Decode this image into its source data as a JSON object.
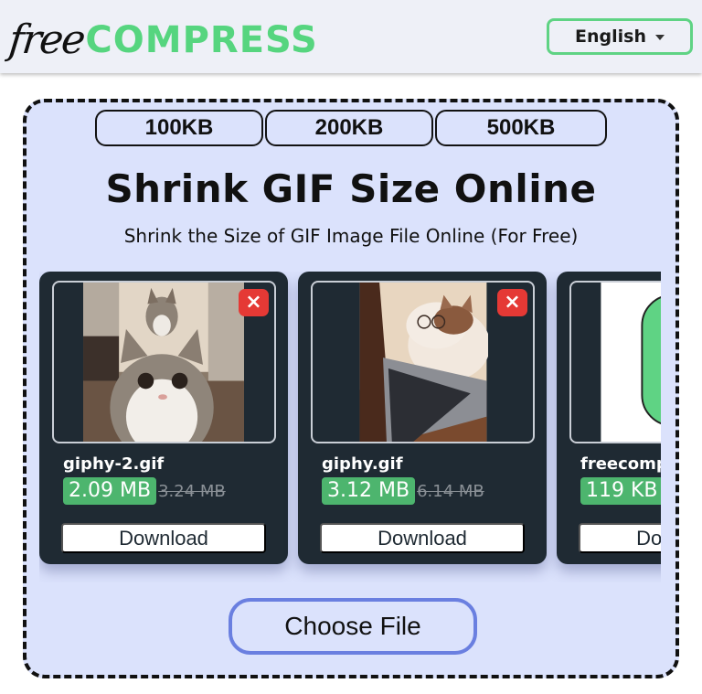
{
  "header": {
    "logo_free": "free",
    "logo_compress": "COMPRESS",
    "language": "English"
  },
  "main": {
    "size_presets": [
      "100KB",
      "200KB",
      "500KB"
    ],
    "title": "Shrink GIF Size Online",
    "subtitle": "Shrink the Size of GIF Image File Online (For Free)",
    "files": [
      {
        "name": "giphy-2.gif",
        "new_size": "2.09 MB",
        "old_size": "3.24 MB",
        "download_label": "Download",
        "close_icon": "×"
      },
      {
        "name": "giphy.gif",
        "new_size": "3.12 MB",
        "old_size": "6.14 MB",
        "download_label": "Download",
        "close_icon": "×"
      },
      {
        "name": "freecompress",
        "new_size": "119 KB",
        "old_size": "",
        "download_label": "Download",
        "close_icon": "×"
      }
    ],
    "choose_file_label": "Choose File"
  },
  "colors": {
    "brand_green": "#56d57f",
    "card_bg": "#1f2a33",
    "size_badge": "#4db56e",
    "close_red": "#e53935",
    "drop_zone_bg": "#dbe2fc",
    "choose_border": "#6a7fe0"
  }
}
